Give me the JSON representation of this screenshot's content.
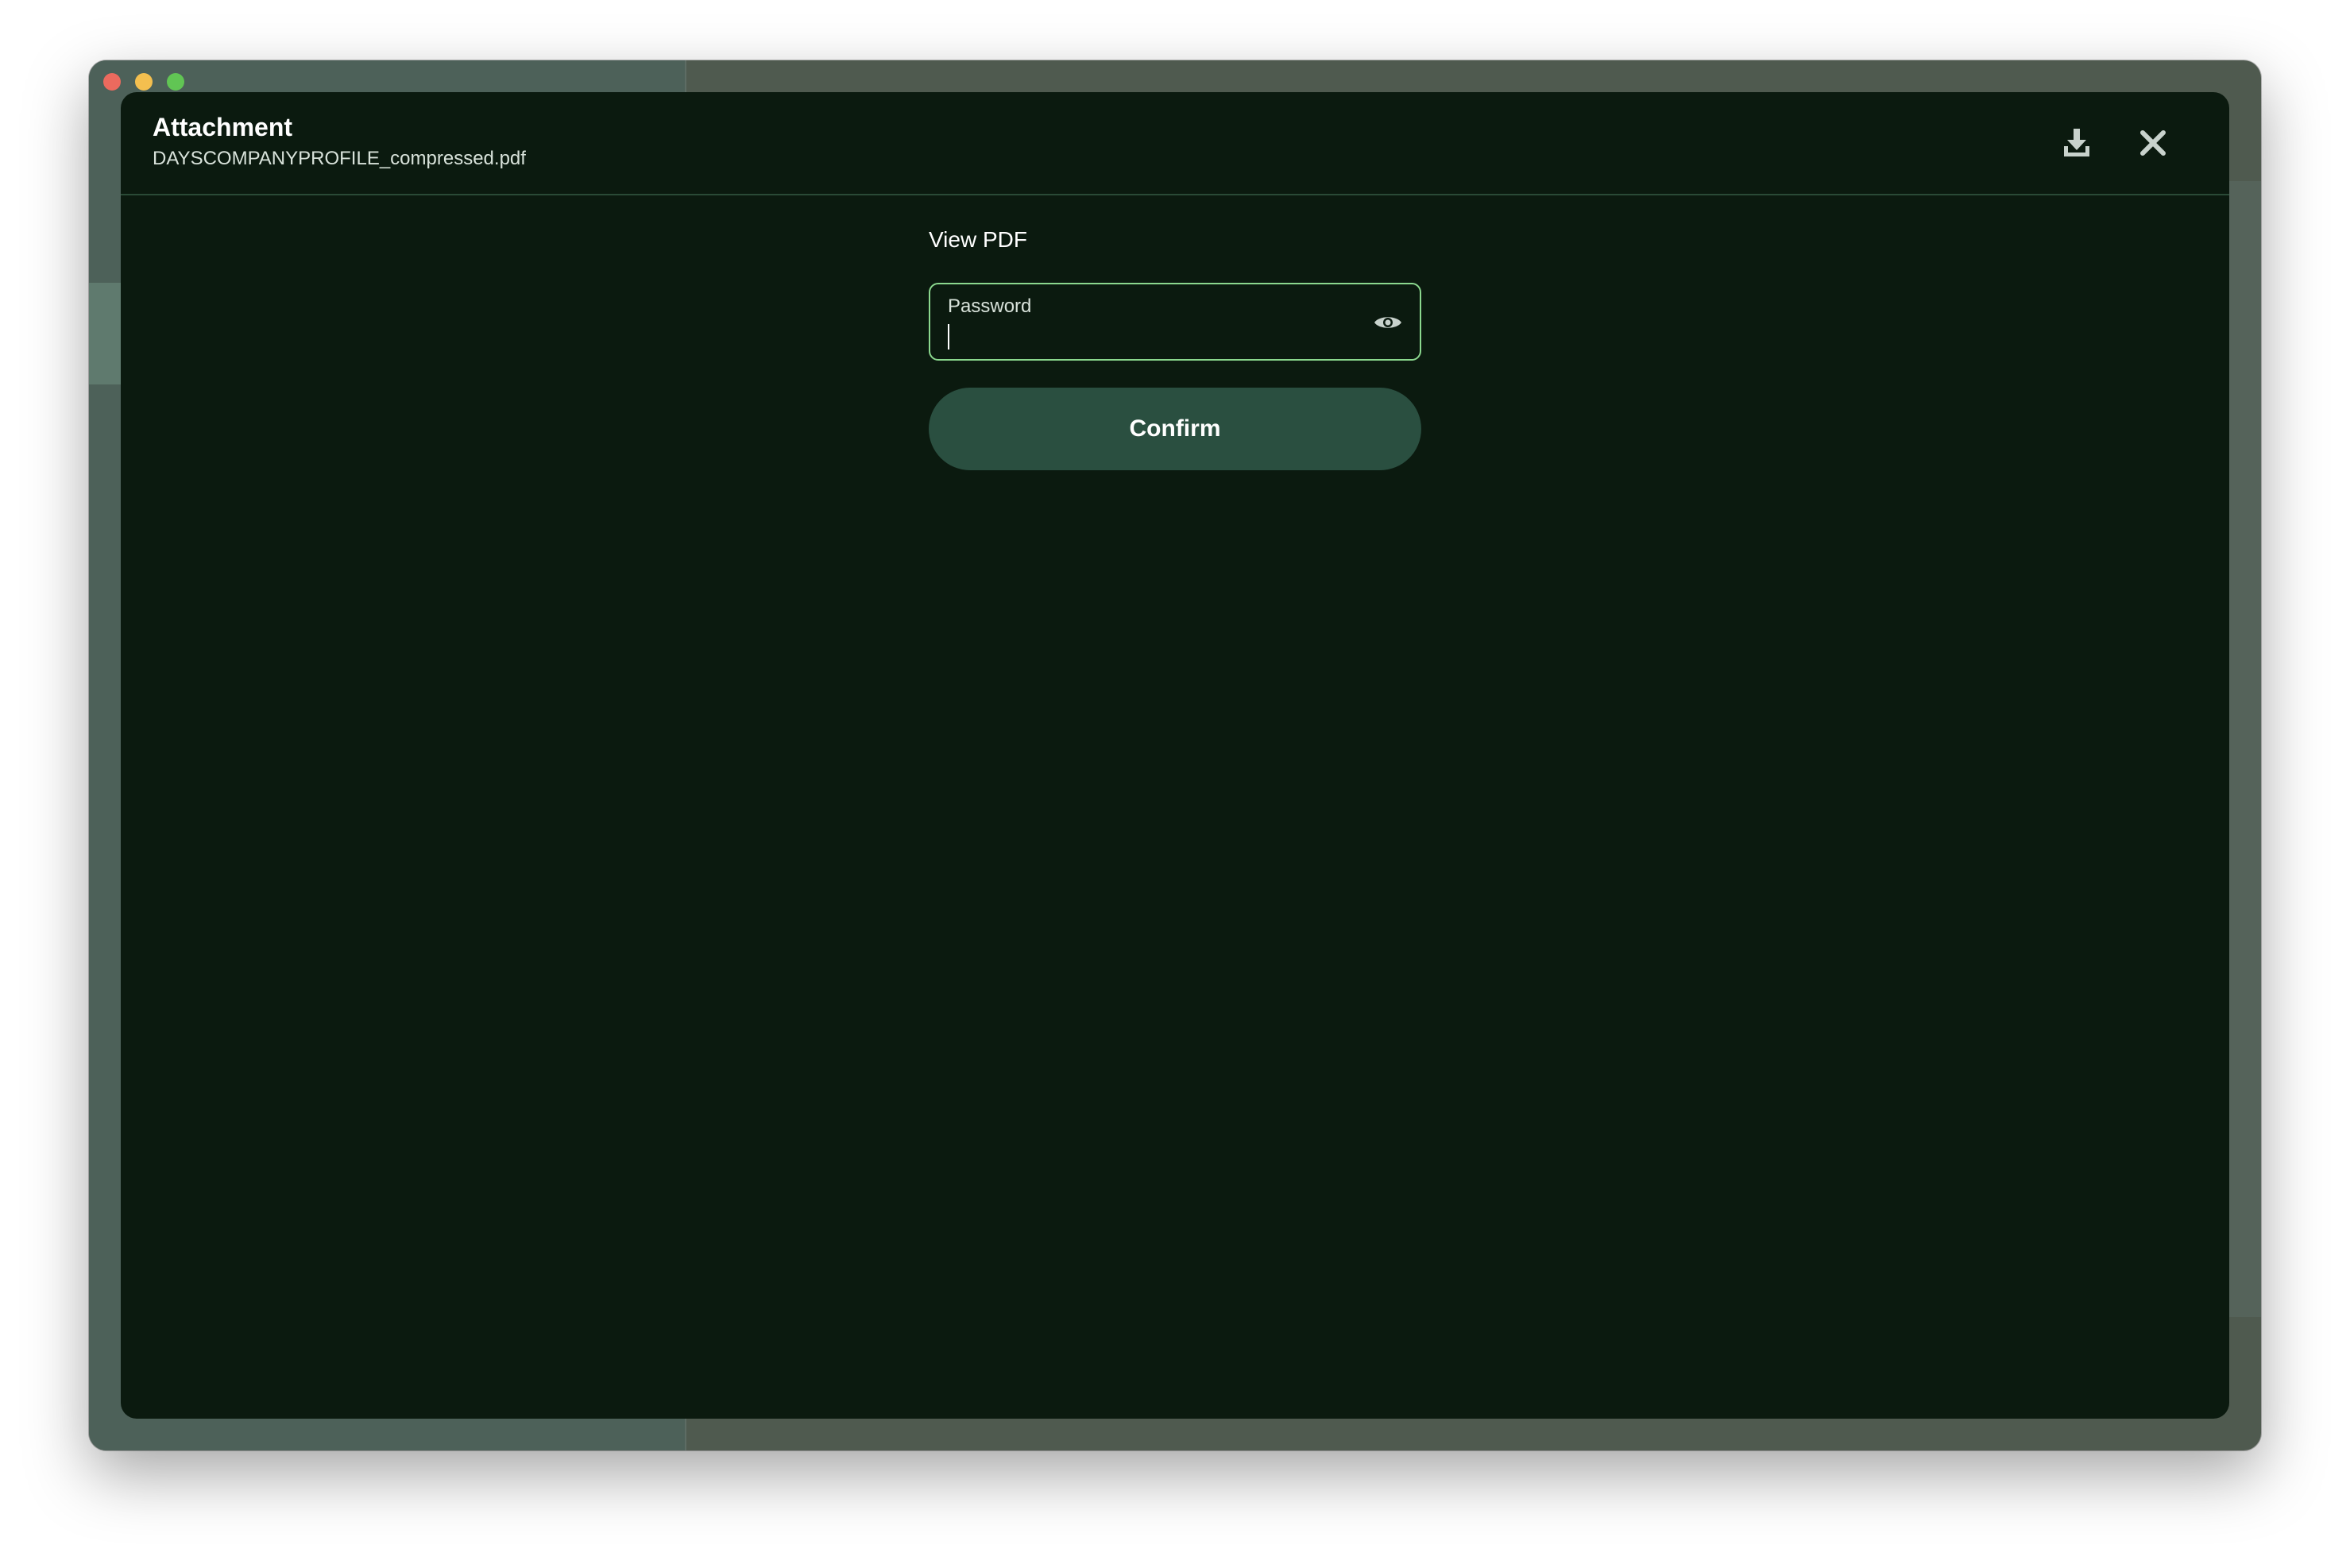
{
  "modal": {
    "title": "Attachment",
    "filename": "DAYSCOMPANYPROFILE_compressed.pdf",
    "actions": {
      "download_icon": "download-icon",
      "close_icon": "close-icon"
    }
  },
  "form": {
    "heading": "View PDF",
    "password": {
      "label": "Password",
      "value": "",
      "reveal_icon": "eye-icon"
    },
    "confirm_label": "Confirm"
  },
  "colors": {
    "modal_bg": "#0b1a0f",
    "accent_border": "#8bd88e",
    "button_bg": "#2a4f40",
    "text": "#ffffff"
  }
}
